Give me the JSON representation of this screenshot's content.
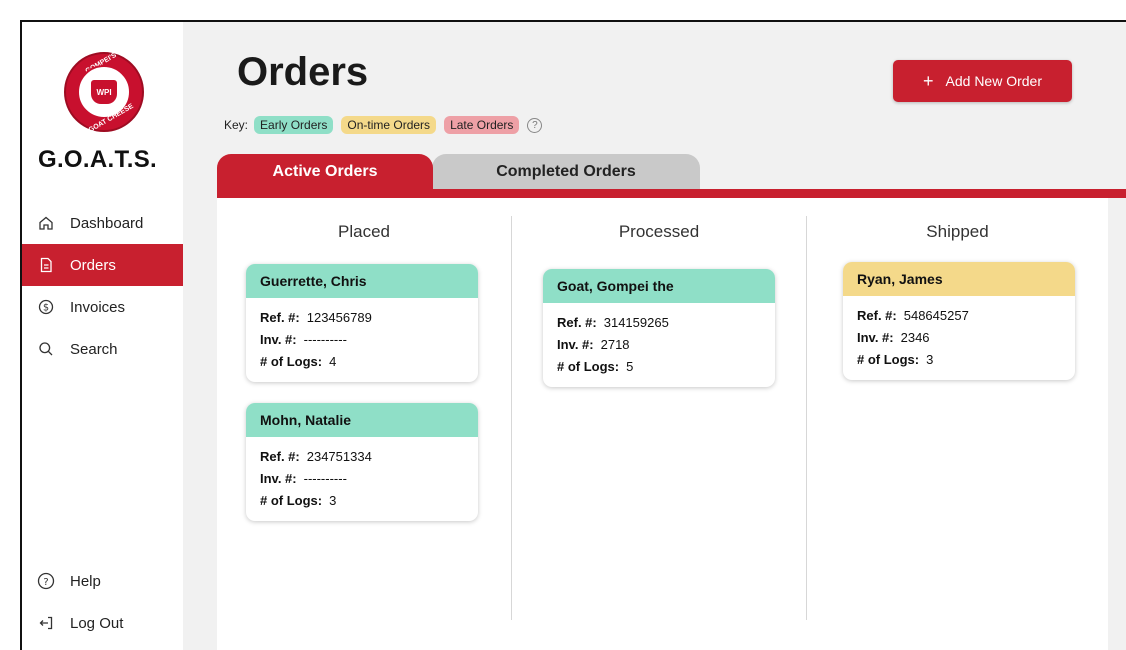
{
  "sidebar": {
    "logo_text": "WPI",
    "logo_ring_top": "GOMPEI'S",
    "logo_ring_bottom": "GOAT CHEESE",
    "brand": "G.O.A.T.S.",
    "items": [
      {
        "label": "Dashboard",
        "icon": "home-icon"
      },
      {
        "label": "Orders",
        "icon": "document-icon",
        "active": true
      },
      {
        "label": "Invoices",
        "icon": "dollar-icon"
      },
      {
        "label": "Search",
        "icon": "search-icon"
      }
    ],
    "bottom_items": [
      {
        "label": "Help",
        "icon": "help-icon"
      },
      {
        "label": "Log Out",
        "icon": "logout-icon"
      }
    ]
  },
  "header": {
    "title": "Orders",
    "key_label": "Key:",
    "key_early": "Early Orders",
    "key_ontime": "On-time Orders",
    "key_late": "Late Orders",
    "key_help": "?",
    "add_button_plus": "+",
    "add_button_label": "Add New Order"
  },
  "tabs": [
    {
      "label": "Active Orders",
      "active": true
    },
    {
      "label": "Completed Orders",
      "active": false
    }
  ],
  "labels": {
    "ref": "Ref. #:",
    "inv": "Inv. #:",
    "logs": "# of Logs:"
  },
  "columns": [
    {
      "title": "Placed",
      "cards": [
        {
          "name": "Guerrette, Chris",
          "status": "early",
          "ref": "123456789",
          "inv": "----------",
          "logs": "4"
        },
        {
          "name": "Mohn, Natalie",
          "status": "early",
          "ref": "234751334",
          "inv": "----------",
          "logs": "3"
        }
      ]
    },
    {
      "title": "Processed",
      "cards": [
        {
          "name": "Goat, Gompei the",
          "status": "early",
          "ref": "314159265",
          "inv": "2718",
          "logs": "5"
        }
      ]
    },
    {
      "title": "Shipped",
      "cards": [
        {
          "name": "Ryan, James",
          "status": "ontime",
          "ref": "548645257",
          "inv": "2346",
          "logs": "3"
        }
      ]
    }
  ],
  "colors": {
    "accent": "#c8202f",
    "early": "#8fdfc7",
    "ontime": "#f4d98a",
    "late": "#eea0a6"
  }
}
